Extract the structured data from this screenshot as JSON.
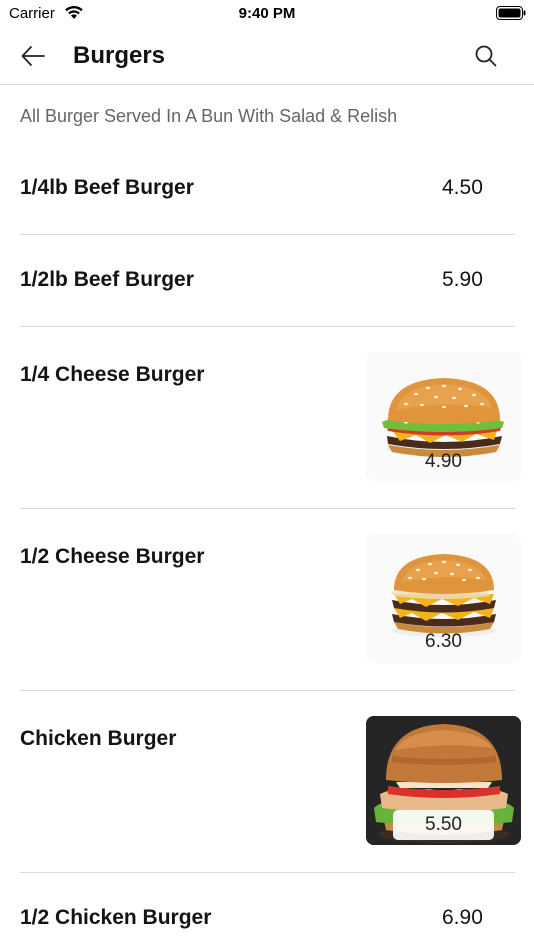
{
  "status": {
    "carrier": "Carrier",
    "time": "9:40 PM"
  },
  "nav": {
    "title": "Burgers",
    "back_icon": "arrow-left-icon",
    "search_icon": "search-icon"
  },
  "category": {
    "subtitle": "All Burger Served In A Bun With Salad & Relish"
  },
  "items": [
    {
      "name": "1/4lb Beef Burger",
      "price": "4.50",
      "has_image": false
    },
    {
      "name": "1/2lb Beef Burger",
      "price": "5.90",
      "has_image": false
    },
    {
      "name": "1/4 Cheese Burger",
      "price": "4.90",
      "has_image": true,
      "image": "cheeseburger-photo"
    },
    {
      "name": "1/2 Cheese Burger",
      "price": "6.30",
      "has_image": true,
      "image": "double-cheeseburger-photo"
    },
    {
      "name": "Chicken Burger",
      "price": "5.50",
      "has_image": true,
      "image": "chicken-burger-photo"
    },
    {
      "name": "1/2 Chicken Burger",
      "price": "6.90",
      "has_image": false
    }
  ],
  "colors": {
    "divider": "#d9d9d9",
    "subtitle": "#666666",
    "text": "#141414"
  }
}
